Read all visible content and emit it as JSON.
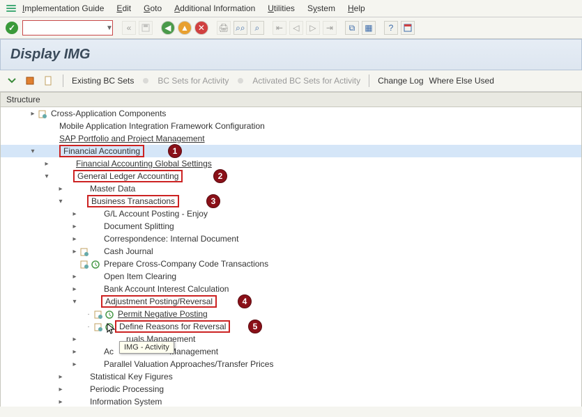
{
  "menu": {
    "implementation_guide": "Implementation Guide",
    "edit": "Edit",
    "goto": "Goto",
    "additional_info": "Additional Information",
    "utilities": "Utilities",
    "system": "System",
    "help": "Help"
  },
  "title": "Display IMG",
  "subtoolbar": {
    "existing_bc_sets": "Existing BC Sets",
    "bc_sets_for_activity": "BC Sets for Activity",
    "activated_bc_sets": "Activated BC Sets for Activity",
    "change_log": "Change Log",
    "where_else_used": "Where Else Used"
  },
  "structure_header": "Structure",
  "tree": {
    "n0": "Cross-Application Components",
    "n1": "Mobile Application Integration Framework Configuration",
    "n2": "SAP Portfolio and Project Management",
    "n3": "Financial Accounting",
    "n4": "Financial Accounting Global Settings",
    "n5": "General Ledger Accounting",
    "n6": "Master Data",
    "n7": "Business Transactions",
    "n8": "G/L Account Posting - Enjoy",
    "n9": "Document Splitting",
    "n10": "Correspondence: Internal Document",
    "n11": "Cash Journal",
    "n12": "Prepare Cross-Company Code Transactions",
    "n13": "Open Item Clearing",
    "n14": "Bank Account Interest Calculation",
    "n15": "Adjustment Posting/Reversal",
    "n16": "Permit Negative Posting",
    "n17": "Define Reasons for Reversal",
    "n18_a": "ruals Management",
    "n19_a": "Ac",
    "n19_b": "Management",
    "n20": "Parallel Valuation Approaches/Transfer Prices",
    "n21": "Statistical Key Figures",
    "n22": "Periodic Processing",
    "n23": "Information System"
  },
  "badges": [
    "1",
    "2",
    "3",
    "4",
    "5"
  ],
  "tooltip": "IMG - Activity"
}
